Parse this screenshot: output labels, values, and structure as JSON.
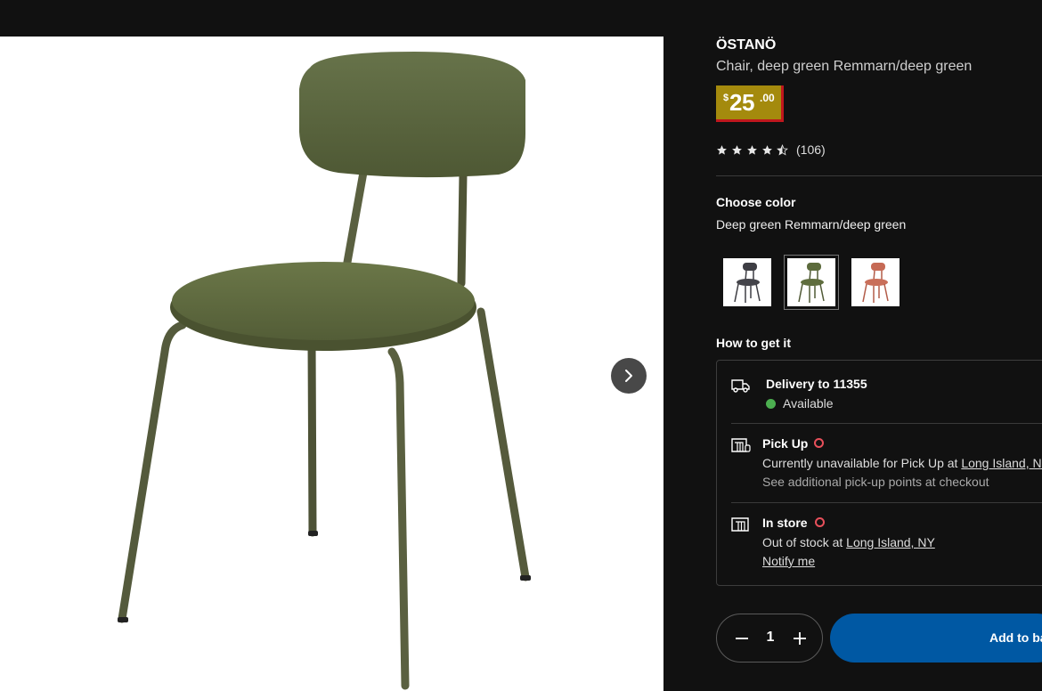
{
  "product": {
    "name": "ÖSTANÖ",
    "description": "Chair, deep green Remmarn/deep green",
    "price": {
      "currency": "$",
      "integer": "25",
      "decimal": ".00"
    },
    "rating": {
      "stars": 4.5,
      "count": "(106)"
    },
    "image": "deep-green-chair"
  },
  "gallery": {
    "next_icon": "chevron-right-icon"
  },
  "color": {
    "heading": "Choose color",
    "selected": "Deep green Remmarn/deep green",
    "swatches": [
      {
        "name": "dark-gray",
        "color": "#4a4a4f"
      },
      {
        "name": "deep-green",
        "color": "#5c6b3c",
        "selected": true
      },
      {
        "name": "red-brown",
        "color": "#c66a55"
      }
    ]
  },
  "fulfillment": {
    "heading": "How to get it",
    "delivery": {
      "title": "Delivery to 11355",
      "status": "Available",
      "status_color": "#4caf50"
    },
    "pickup": {
      "title": "Pick Up",
      "line1_prefix": "Currently unavailable for Pick Up at ",
      "line1_link": "Long Island, NY",
      "line2": "See additional pick-up points at checkout"
    },
    "instore": {
      "title": "In store",
      "line1_prefix": "Out of stock at ",
      "line1_link": "Long Island, NY",
      "notify": "Notify me"
    }
  },
  "cart": {
    "quantity": "1",
    "add_label": "Add to bag",
    "button_color": "#0058a3"
  }
}
